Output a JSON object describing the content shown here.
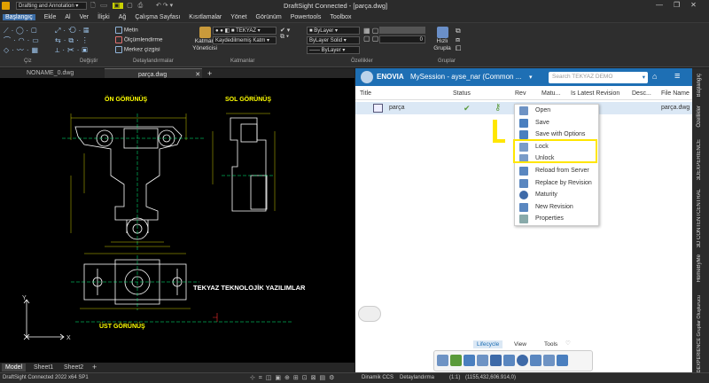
{
  "titlebar": {
    "workspace": "Drafting and Annotation",
    "title": "DraftSight Connected - [parça.dwg]"
  },
  "menu": [
    "Başlangıç",
    "Ekle",
    "Al",
    "Ver",
    "İlişki",
    "Ağ",
    "Çalışma Sayfası",
    "Kısıtlamalar",
    "Yönet",
    "Görünüm",
    "Powertools",
    "Toolbox"
  ],
  "ribbon": {
    "groups": [
      "Çiz",
      "Değiştir",
      "Detaylandırmalar",
      "Katmanlar",
      "Özellikler",
      "Gruplar"
    ],
    "metin": "Metin",
    "olcumlendirme": "Ölçümlendirme",
    "merkez": "Merkez çizgisi",
    "katman_yonetici": "Katman Yöneticisi",
    "layer_name": "TEKYAZ",
    "kaydedilmemis": "Kaydedilmemiş Katm",
    "bylayer1": "ByLayer",
    "bylayer2": "ByLayer",
    "solid": "Solid",
    "bylayer3": "ByLayer",
    "zero": "0",
    "hizli_grupla": "Hızlı Grupla"
  },
  "doctabs": [
    "NONAME_0.dwg",
    "parça.dwg"
  ],
  "drawing": {
    "front_title": "ÖN GÖRÜNÜŞ",
    "side_title": "SOL GÖRÜNÜŞ",
    "top_title": "ÜST GÖRÜNÜŞ",
    "company": "TEKYAZ TEKNOLOJİK YAZILIMLAR",
    "axis_x": "X",
    "axis_y": "Y"
  },
  "sheettabs": [
    "Model",
    "Sheet1",
    "Sheet2"
  ],
  "status": {
    "version": "DraftSight Connected 2022  x64 SP1",
    "ccs": "Dinamik CCS",
    "detail": "Detaylandırma",
    "scale": "(1:1)",
    "coords": "(1155,432,606.914,0)"
  },
  "panel": {
    "brand": "ENOVIA",
    "session": "MySession - ayse_nar (Common ...",
    "search_placeholder": "Search TEKYAZ DEMO",
    "columns": [
      "Title",
      "Status",
      "Rev",
      "Matu...",
      "Is Latest Revision",
      "Desc...",
      "File Name"
    ],
    "row": {
      "title": "parça",
      "file": "parça.dwg"
    },
    "context_menu": [
      "Open",
      "Save",
      "Save with Options",
      "Lock",
      "Unlock",
      "Reload from Server",
      "Replace by Revision",
      "Maturity",
      "New Revision",
      "Properties"
    ],
    "tabs": [
      "Lifecycle",
      "View",
      "Tools"
    ]
  },
  "side_tabs": [
    "Başlangıç",
    "Özellikler",
    "3DEXPERIENCE",
    "3D CONTENTCENTRAL",
    "HomeByMe",
    "3DEXPERIENCE Gruplar Oluşturucu"
  ],
  "colors": {
    "accent": "#1e6fb4",
    "highlight": "#ffe600",
    "cad": "#ffff00"
  }
}
